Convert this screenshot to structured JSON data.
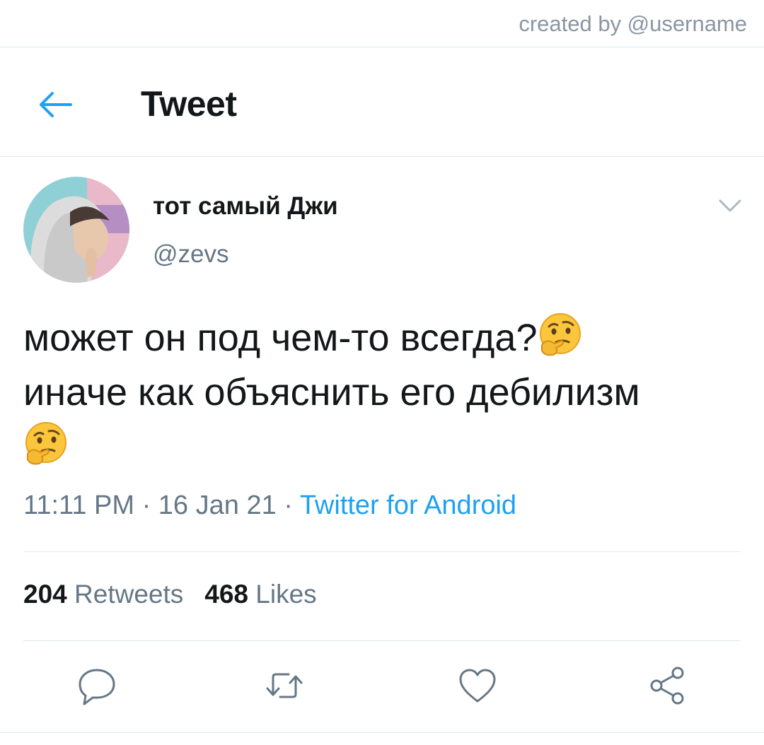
{
  "watermark": "created by @username",
  "header": {
    "title": "Tweet",
    "back_icon": "arrow-left-icon"
  },
  "tweet": {
    "display_name": "тот самый Джи",
    "handle": "@zevs",
    "text_line1": "может он под чем-то всегда?",
    "text_line2": "иначе как объяснить его дебилизм",
    "emoji": "thinking-face",
    "time": "11:11 PM",
    "date": "16 Jan 21",
    "source": "Twitter for Android",
    "retweets_count": "204",
    "retweets_label": "Retweets",
    "likes_count": "468",
    "likes_label": "Likes"
  },
  "actions": [
    "reply-icon",
    "retweet-icon",
    "like-icon",
    "share-icon"
  ],
  "colors": {
    "accent": "#1da1f2",
    "muted": "#657786",
    "text": "#14171a",
    "divider": "#e1e8ed"
  }
}
